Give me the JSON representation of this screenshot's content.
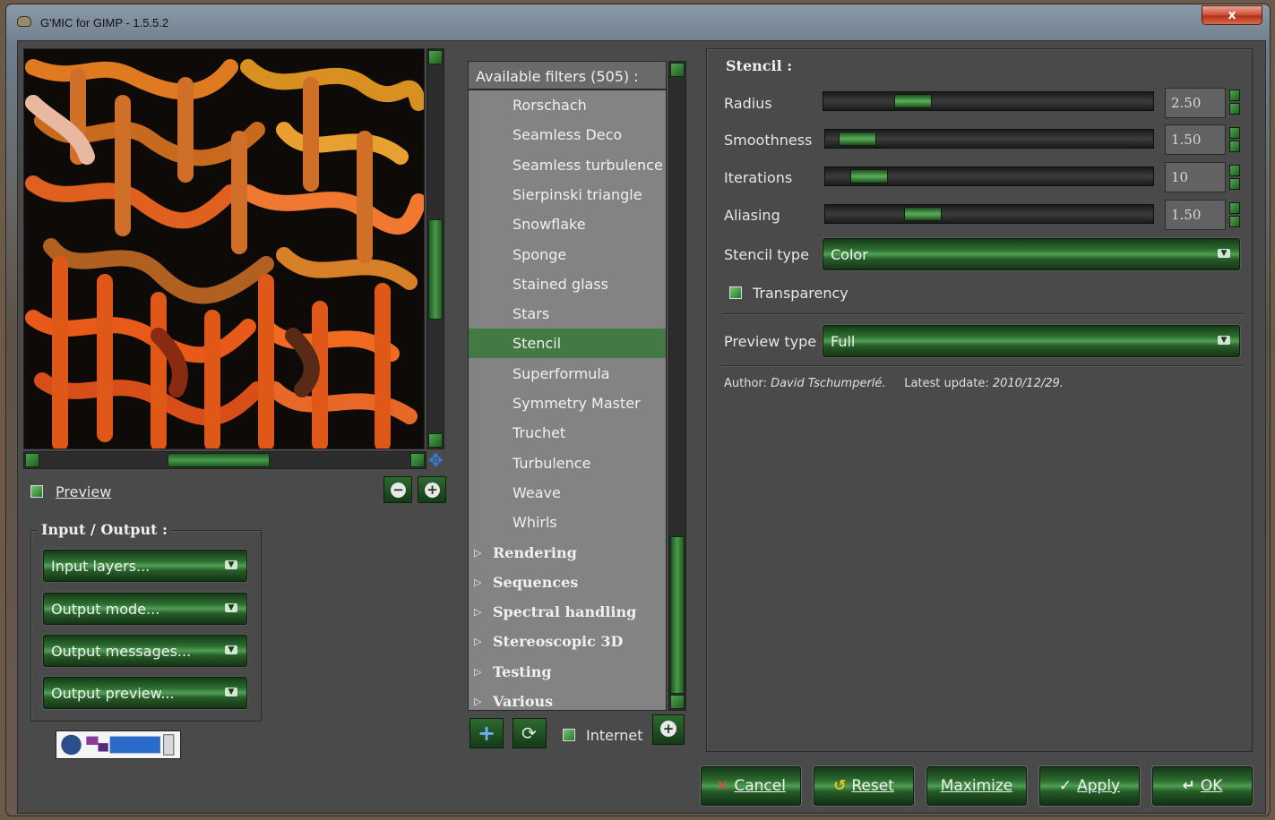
{
  "window": {
    "title": "G'MIC for GIMP - 1.5.5.2",
    "close_label": "x"
  },
  "preview": {
    "checkbox_label": "Preview",
    "zoom_out_label": "−",
    "zoom_in_label": "+"
  },
  "io": {
    "title": "Input / Output :",
    "input_layers": "Input layers...",
    "output_mode": "Output mode...",
    "output_messages": "Output messages...",
    "output_preview": "Output preview..."
  },
  "filters": {
    "header": "Available filters (505) :",
    "items": [
      {
        "label": "Rorschach",
        "kind": "filter"
      },
      {
        "label": "Seamless Deco",
        "kind": "filter"
      },
      {
        "label": "Seamless turbulence",
        "kind": "filter"
      },
      {
        "label": "Sierpinski triangle",
        "kind": "filter"
      },
      {
        "label": "Snowflake",
        "kind": "filter"
      },
      {
        "label": "Sponge",
        "kind": "filter"
      },
      {
        "label": "Stained glass",
        "kind": "filter"
      },
      {
        "label": "Stars",
        "kind": "filter"
      },
      {
        "label": "Stencil",
        "kind": "filter",
        "selected": true
      },
      {
        "label": "Superformula",
        "kind": "filter"
      },
      {
        "label": "Symmetry Master",
        "kind": "filter"
      },
      {
        "label": "Truchet",
        "kind": "filter"
      },
      {
        "label": "Turbulence",
        "kind": "filter"
      },
      {
        "label": "Weave",
        "kind": "filter"
      },
      {
        "label": "Whirls",
        "kind": "filter"
      },
      {
        "label": "Rendering",
        "kind": "category"
      },
      {
        "label": "Sequences",
        "kind": "category"
      },
      {
        "label": "Spectral handling",
        "kind": "category"
      },
      {
        "label": "Stereoscopic 3D",
        "kind": "category"
      },
      {
        "label": "Testing",
        "kind": "category"
      },
      {
        "label": "Various",
        "kind": "category"
      }
    ],
    "add_icon": "plus-icon",
    "refresh_icon": "refresh-icon",
    "internet_label": "Internet",
    "internet_icon": "plus-circle-icon"
  },
  "params": {
    "title": "Stencil :",
    "radius_label": "Radius",
    "radius_value": "2.50",
    "radius_fraction": 0.24,
    "smoothness_label": "Smoothness",
    "smoothness_value": "1.50",
    "smoothness_fraction": 0.04,
    "iterations_label": "Iterations",
    "iterations_value": "10",
    "iterations_fraction": 0.08,
    "aliasing_label": "Aliasing",
    "aliasing_value": "1.50",
    "aliasing_fraction": 0.27,
    "stencil_type_label": "Stencil type",
    "stencil_type_value": "Color",
    "transparency_label": "Transparency",
    "preview_type_label": "Preview type",
    "preview_type_value": "Full",
    "author_label": "Author:",
    "author_name": "David Tschumperlé.",
    "update_label": "Latest update:",
    "update_date": "2010/12/29."
  },
  "actions": {
    "cancel": "Cancel",
    "reset": "Reset",
    "maximize": "Maximize",
    "apply": "Apply",
    "ok": "OK"
  },
  "colors": {
    "accent_green": "#437a44",
    "panel": "#4a4a4a"
  }
}
